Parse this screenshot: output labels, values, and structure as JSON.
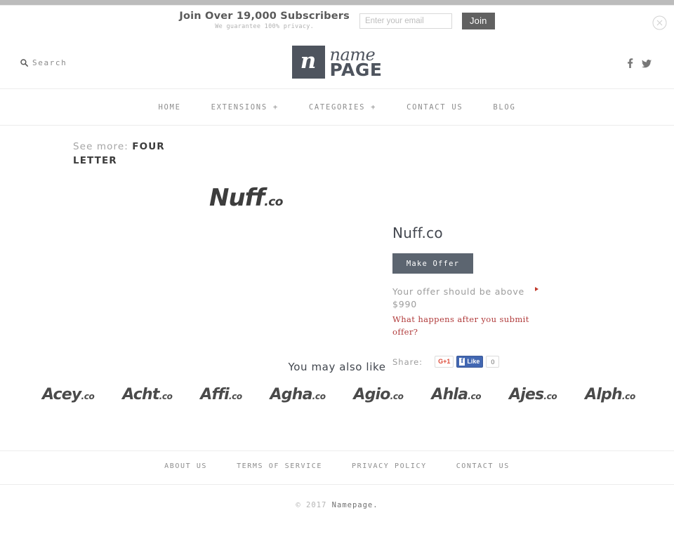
{
  "subscribe_bar": {
    "title": "Join Over 19,000 Subscribers",
    "subtitle": "We guarantee 100% privacy.",
    "email_placeholder": "Enter your email",
    "email_value": "",
    "join_label": "Join",
    "close_icon": "close-circle-icon"
  },
  "header": {
    "search_label": "Search",
    "search_icon": "search-icon",
    "logo": {
      "mark_letter": "n",
      "name_word": "name",
      "page_word": "PAGE"
    },
    "social": [
      {
        "name": "facebook-icon",
        "label": "f"
      },
      {
        "name": "twitter-icon",
        "label": "t"
      }
    ]
  },
  "nav": {
    "items": [
      {
        "label": "HOME"
      },
      {
        "label": "EXTENSIONS +"
      },
      {
        "label": "CATEGORIES +"
      },
      {
        "label": "CONTACT US"
      },
      {
        "label": "BLOG"
      }
    ]
  },
  "breadcrumb": {
    "label": "See more:",
    "value": "FOUR LETTER"
  },
  "product": {
    "image_name": "Nuff",
    "image_tld": ".co",
    "title": "Nuff.co",
    "make_offer_label": "Make Offer",
    "offer_note": "Your offer should be above $990",
    "offer_minimum": "$990",
    "offer_link": "What happens after you submit offer?",
    "share_label": "Share:",
    "gplus_label": "G+1",
    "fb_f": "f",
    "fb_like_label": "Like",
    "fb_count": "0"
  },
  "related": {
    "title": "You may also like",
    "items": [
      {
        "name": "Acey",
        "tld": ".co"
      },
      {
        "name": "Acht",
        "tld": ".co"
      },
      {
        "name": "Affi",
        "tld": ".co"
      },
      {
        "name": "Agha",
        "tld": ".co"
      },
      {
        "name": "Agio",
        "tld": ".co"
      },
      {
        "name": "Ahla",
        "tld": ".co"
      },
      {
        "name": "Ajes",
        "tld": ".co"
      },
      {
        "name": "Alph",
        "tld": ".co"
      }
    ]
  },
  "footer": {
    "links": [
      {
        "label": "ABOUT US"
      },
      {
        "label": "TERMS OF SERVICE"
      },
      {
        "label": "PRIVACY POLICY"
      },
      {
        "label": "CONTACT US"
      }
    ],
    "copyright_mark": "© 2017",
    "copyright_name": "Namepage."
  },
  "colors": {
    "logo": "#4e545e",
    "button": "#5c6570",
    "accent_red": "#b03a3a",
    "join_button": "#616161"
  }
}
